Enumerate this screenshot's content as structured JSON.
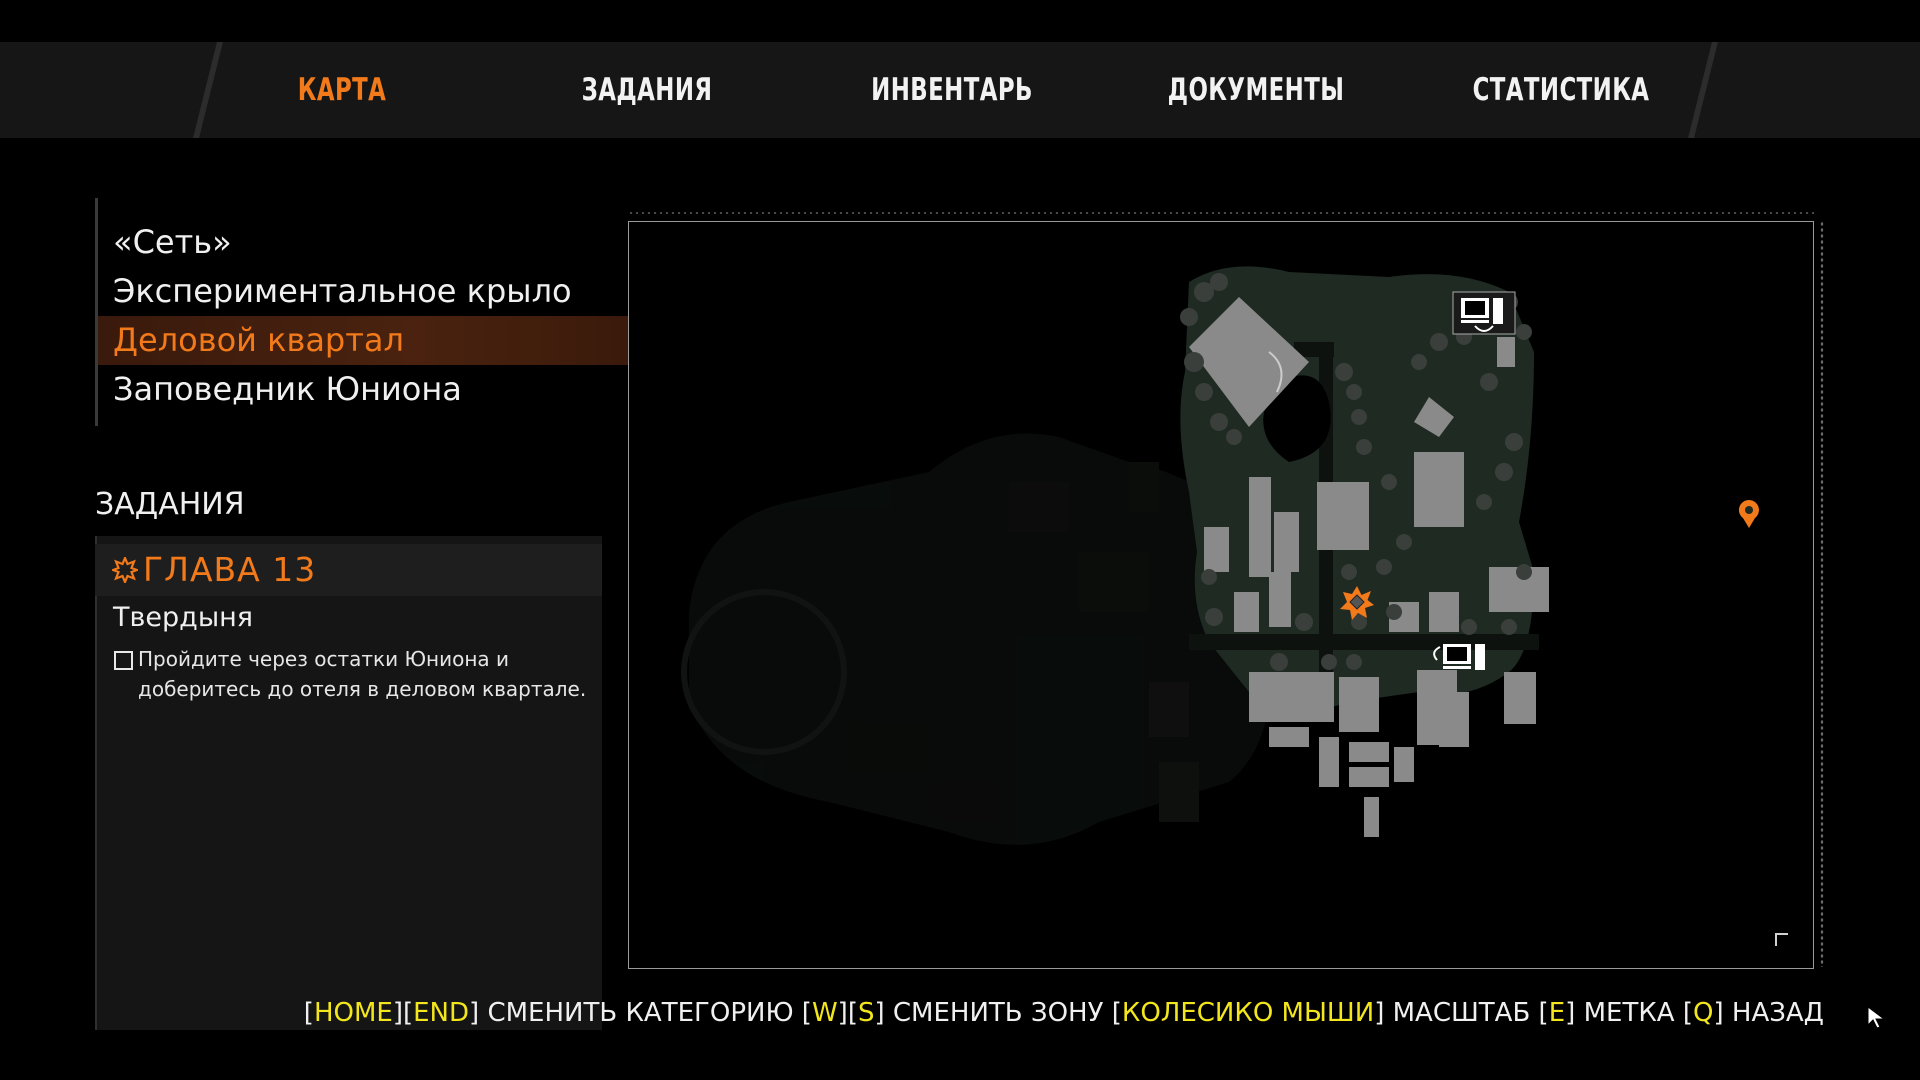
{
  "tabs": [
    {
      "label": "КАРТА",
      "active": true
    },
    {
      "label": "ЗАДАНИЯ",
      "active": false
    },
    {
      "label": "ИНВЕНТАРЬ",
      "active": false
    },
    {
      "label": "ДОКУМЕНТЫ",
      "active": false
    },
    {
      "label": "СТАТИСТИКА",
      "active": false
    }
  ],
  "zones": [
    {
      "label": "«Сеть»",
      "active": false
    },
    {
      "label": "Экспериментальное крыло",
      "active": false
    },
    {
      "label": "Деловой квартал",
      "active": true
    },
    {
      "label": "Заповедник Юниона",
      "active": false
    }
  ],
  "quests": {
    "title": "ЗАДАНИЯ",
    "chapter": "ГЛАВА 13",
    "name": "Твердыня",
    "objective": "Пройдите через остатки Юниона и доберитесь до отеля в деловом квартале.",
    "objective_done": false
  },
  "map": {
    "icons": [
      "computer-terminal-icon",
      "computer-terminal-icon",
      "quest-objective-icon",
      "location-pin-icon"
    ]
  },
  "hints": {
    "k1": "HOME",
    "k2": "END",
    "t1": "СМЕНИТЬ КАТЕГОРИЮ",
    "k3": "W",
    "k4": "S",
    "t2": "СМЕНИТЬ ЗОНУ",
    "k5": "КОЛЕСИКО МЫШИ",
    "t3": "МАСШТАБ",
    "k6": "E",
    "t4": "МЕТКА",
    "k7": "Q",
    "t5": "НАЗАД"
  },
  "colors": {
    "accent": "#f27a1a",
    "key_hint": "#f3e61c",
    "map_green": "#1b2a20",
    "building": "#8a8a8a"
  }
}
